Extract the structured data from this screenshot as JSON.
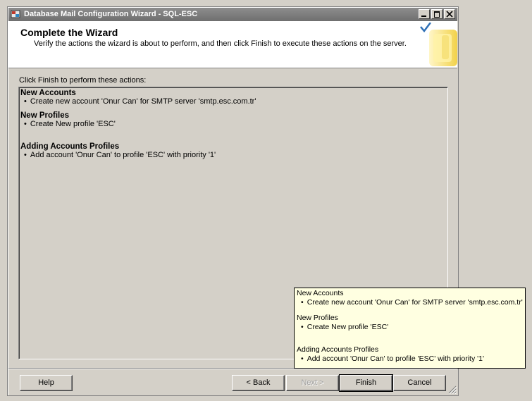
{
  "window": {
    "title": "Database Mail Configuration Wizard - SQL-ESC"
  },
  "header": {
    "title": "Complete the Wizard",
    "description": "Verify the actions the wizard is about to perform, and then click Finish to execute these actions on the server."
  },
  "instruction": "Click Finish to perform these actions:",
  "actions": {
    "new_accounts": {
      "heading": "New Accounts",
      "items": [
        "Create new account 'Onur Can' for SMTP server 'smtp.esc.com.tr'"
      ]
    },
    "new_profiles": {
      "heading": "New Profiles",
      "items": [
        "Create New profile 'ESC'"
      ]
    },
    "adding_accounts_profiles": {
      "heading": "Adding Accounts Profiles",
      "items": [
        "Add account 'Onur Can' to profile 'ESC' with priority '1'"
      ]
    }
  },
  "buttons": {
    "help": "Help",
    "back": "< Back",
    "next": "Next >",
    "finish": "Finish",
    "cancel": "Cancel"
  },
  "tooltip": {
    "new_accounts_heading": "New Accounts",
    "new_accounts_item": "Create new account 'Onur Can' for SMTP server 'smtp.esc.com.tr'",
    "new_profiles_heading": "New Profiles",
    "new_profiles_item": "Create New profile 'ESC'",
    "adding_heading": "Adding Accounts Profiles",
    "adding_item": "Add account 'Onur Can' to profile 'ESC' with priority '1'"
  },
  "colors": {
    "face": "#d4d0c8",
    "titlebar": "#7a7a7a",
    "tooltip_bg": "#ffffe1"
  }
}
